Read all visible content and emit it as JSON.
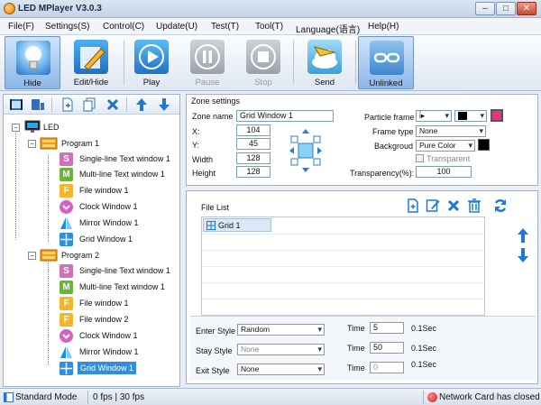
{
  "window": {
    "title": "LED MPlayer V3.0.3",
    "minimize": "–",
    "maximize": "□",
    "close": "✕"
  },
  "menu": [
    "File(F)",
    "Settings(S)",
    "Control(C)",
    "Update(U)",
    "Test(T)",
    "Tool(T)",
    "Language(语言)",
    "Help(H)"
  ],
  "toolbar": {
    "hide": "Hide",
    "edit_hide": "Edit/Hide",
    "play": "Play",
    "pause": "Pause",
    "stop": "Stop",
    "send": "Send",
    "unlinked": "Unlinked"
  },
  "tree": {
    "root": "LED",
    "program1": "Program 1",
    "program1_items": [
      "Single-line Text window 1",
      "Multi-line Text window 1",
      "File window 1",
      "Clock Window 1",
      "Mirror Window 1",
      "Grid Window 1"
    ],
    "program2": "Program 2",
    "program2_items": [
      "Single-line Text window 1",
      "Multi-line Text window 1",
      "File window 1",
      "File window 2",
      "Clock Window 1",
      "Mirror Window 1",
      "Grid Window 1"
    ],
    "icon_letters": {
      "single": "S",
      "multi": "M",
      "file": "F"
    }
  },
  "zone": {
    "title": "Zone settings",
    "zone_name_label": "Zone name",
    "zone_name": "Grid Window 1",
    "x_label": "X:",
    "x": "104",
    "y_label": "Y:",
    "y": "45",
    "width_label": "Width",
    "width": "128",
    "height_label": "Height",
    "height": "128",
    "particle_label": "Particle frame",
    "particle_value": "i̊▸",
    "frame_type_label": "Frame type",
    "frame_type": "None",
    "background_label": "Backgroud",
    "background": "Pure Color",
    "transparent_label": "Transparent",
    "transparency_label": "Transparency(%):",
    "transparency": "100"
  },
  "files": {
    "title": "File List",
    "items": [
      "Grid 1"
    ]
  },
  "effects": {
    "enter_label": "Enter Style",
    "enter_value": "Random",
    "stay_label": "Stay Style",
    "stay_value": "None",
    "exit_label": "Exit Style",
    "exit_value": "None",
    "time_label": "Time",
    "enter_time": "5",
    "stay_time": "50",
    "exit_time": "0",
    "unit": "0.1Sec"
  },
  "status": {
    "mode": "Standard Mode",
    "fps": "0 fps | 30 fps",
    "network": "Network Card has closed"
  },
  "colors": {
    "accent": "#2f8fd8",
    "error": "#d21c1c",
    "pink_swatch": "#e0367c"
  }
}
